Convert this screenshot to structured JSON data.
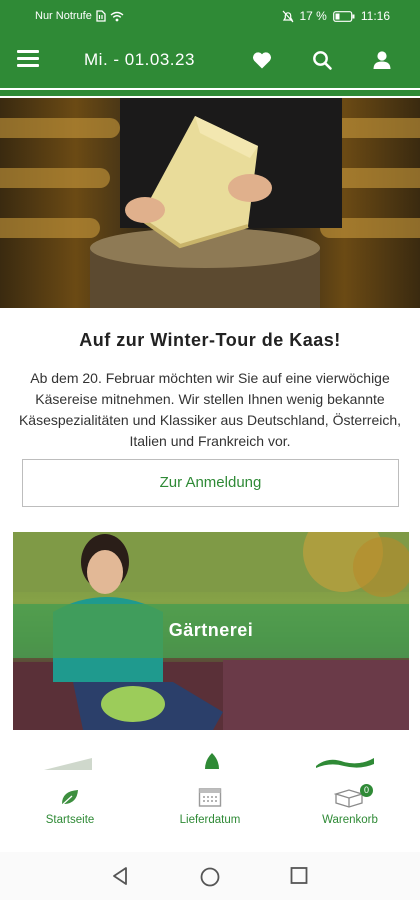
{
  "status_bar": {
    "carrier": "Nur Notrufe",
    "battery": "17 %",
    "time": "11:16"
  },
  "app_bar": {
    "menu_icon": "hamburger-menu-icon",
    "date": "Mi. - 01.03.23",
    "actions": [
      "heart-icon",
      "search-icon",
      "user-icon"
    ]
  },
  "promo": {
    "title": "Auf zur Winter-Tour de Kaas!",
    "text": "Ab dem 20. Februar möchten wir Sie auf eine vierwöchige Käsereise mitnehmen. Wir stellen Ihnen wenig bekannte Käsespezialitäten und Klassiker aus Deutschland, Österreich, Italien und Frankreich vor.",
    "button": "Zur Anmeldung"
  },
  "category": {
    "label": "Gärtnerei"
  },
  "bottom_nav": {
    "items": [
      {
        "label": "Startseite",
        "icon": "leaf-icon"
      },
      {
        "label": "Lieferdatum",
        "icon": "calendar-icon"
      },
      {
        "label": "Warenkorb",
        "icon": "box-icon",
        "badge": "0"
      }
    ]
  },
  "system_nav": [
    "back-icon",
    "home-icon",
    "recents-icon"
  ],
  "colors": {
    "brand_green": "#2f8a36"
  }
}
